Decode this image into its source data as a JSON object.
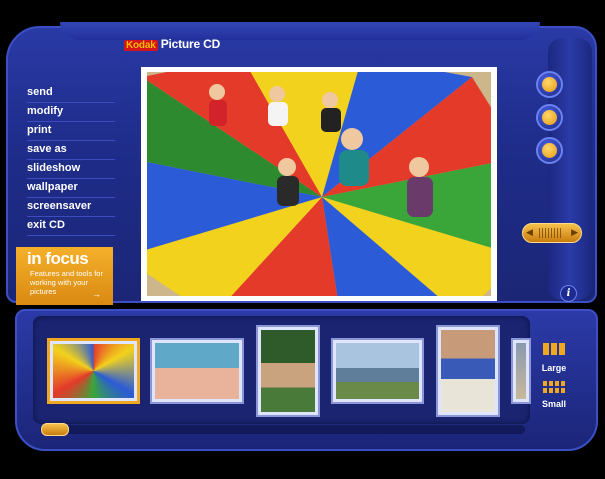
{
  "app": {
    "logo_brand": "Kodak",
    "logo_product": "Picture CD"
  },
  "menu": {
    "items": [
      {
        "label": "send"
      },
      {
        "label": "modify"
      },
      {
        "label": "print"
      },
      {
        "label": "save as"
      },
      {
        "label": "slideshow"
      },
      {
        "label": "wallpaper"
      },
      {
        "label": "screensaver"
      },
      {
        "label": "exit CD"
      }
    ]
  },
  "infocus": {
    "title": "in focus",
    "text": "Features and tools for working with your pictures",
    "arrow": "→"
  },
  "toolbar": {
    "zoom_in_icon": "magnifier-plus-icon",
    "zoom_out_icon": "magnifier-minus-icon",
    "rotate_icon": "rotate-icon",
    "slider_left": "◀",
    "slider_right": "▶",
    "info": "i"
  },
  "thumbnail_size": {
    "large": "Large",
    "small": "Small"
  },
  "colors": {
    "accent": "#f0a820",
    "panel": "#1f2d8c",
    "border": "#3c4fc4"
  }
}
